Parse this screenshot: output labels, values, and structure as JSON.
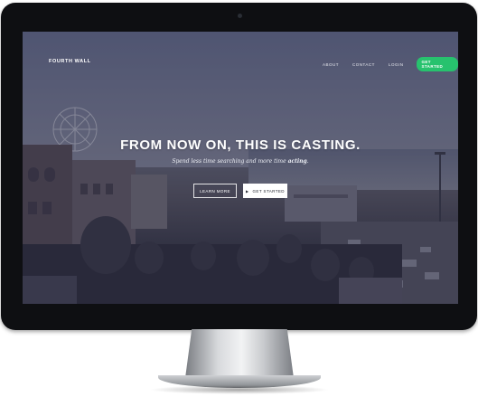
{
  "nav": {
    "brand": "FOURTH WALL",
    "links": [
      "ABOUT",
      "CONTACT",
      "LOGIN"
    ],
    "cta": "GET STARTED"
  },
  "hero": {
    "title": "FROM NOW ON, THIS IS CASTING.",
    "subtitle_pre": "Spend less time searching and more time ",
    "subtitle_emph": "acting",
    "subtitle_post": ".",
    "buttons": {
      "learn_more": "LEARN MORE",
      "get_started": "GET STARTED"
    }
  },
  "colors": {
    "accent_green": "#27c26e",
    "overlay": "#20233e",
    "bezel": "#0e0f12"
  }
}
